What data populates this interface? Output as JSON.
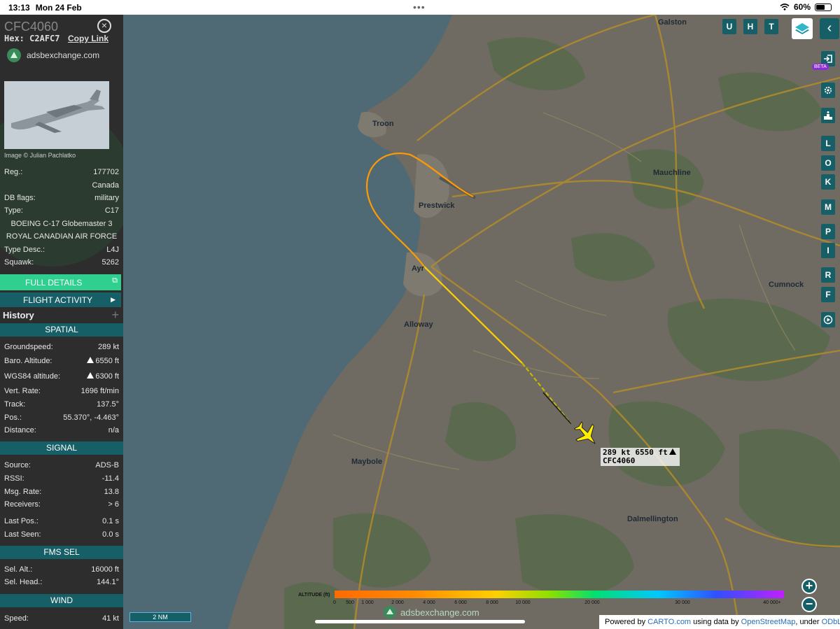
{
  "status_bar": {
    "time": "13:13",
    "date": "Mon 24 Feb",
    "battery": "60%",
    "battery_level": 0.6
  },
  "aircraft": {
    "callsign": "CFC4060",
    "hex_label": "Hex:",
    "hex": "C2AFC7",
    "copy_link": "Copy Link",
    "source_site": "adsbexchange.com",
    "photo_credit": "Image © Julian Pachlatko"
  },
  "info": {
    "reg_label": "Reg.:",
    "reg": "177702",
    "country": "Canada",
    "dbflags_label": "DB flags:",
    "dbflags": "military",
    "type_label": "Type:",
    "type": "C17",
    "model": "BOEING C-17 Globemaster 3",
    "operator": "ROYAL CANADIAN AIR FORCE",
    "typedesc_label": "Type Desc.:",
    "typedesc": "L4J",
    "squawk_label": "Squawk:",
    "squawk": "5262"
  },
  "buttons": {
    "full_details": "FULL DETAILS",
    "flight_activity": "FLIGHT ACTIVITY",
    "history": "History"
  },
  "spatial": {
    "title": "SPATIAL",
    "groundspeed_label": "Groundspeed:",
    "groundspeed": "289 kt",
    "baro_label": "Baro. Altitude:",
    "baro": "6550 ft",
    "wgs_label": "WGS84 altitude:",
    "wgs": "6300 ft",
    "vrate_label": "Vert. Rate:",
    "vrate": "1696 ft/min",
    "track_label": "Track:",
    "track": "137.5°",
    "pos_label": "Pos.:",
    "pos": "55.370°, -4.463°",
    "distance_label": "Distance:",
    "distance": "n/a"
  },
  "signal": {
    "title": "SIGNAL",
    "source_label": "Source:",
    "source": "ADS-B",
    "rssi_label": "RSSI:",
    "rssi": "-11.4",
    "msgrate_label": "Msg. Rate:",
    "msgrate": "13.8",
    "receivers_label": "Receivers:",
    "receivers": "> 6",
    "lastpos_label": "Last Pos.:",
    "lastpos": "0.1 s",
    "lastseen_label": "Last Seen:",
    "lastseen": "0.0 s"
  },
  "fms": {
    "title": "FMS SEL",
    "selalt_label": "Sel. Alt.:",
    "selalt": "16000 ft",
    "selhead_label": "Sel. Head.:",
    "selhead": "144.1°"
  },
  "wind": {
    "title": "WIND",
    "speed_label": "Speed:",
    "speed": "41 kt"
  },
  "map": {
    "places": [
      "Galston",
      "Troon",
      "Mauchline",
      "Prestwick",
      "Ayr",
      "Cumnock",
      "Alloway",
      "Maybole",
      "Dalmellington"
    ],
    "aircraft_label_line1": "289 kt  6550 ft",
    "aircraft_label_line2": "CFC4060",
    "scale": "2 NM",
    "legend_title": "ALTITUDE (ft)",
    "legend_ticks": [
      "0",
      "500",
      "1 000",
      "2 000",
      "4 000",
      "6 000",
      "8 000",
      "10 000",
      "20 000",
      "30 000",
      "40 000+"
    ],
    "watermark": "adsbexchange.com",
    "attribution_1": "Powered by ",
    "attribution_carto": "CARTO.com",
    "attribution_2": " using data by ",
    "attribution_osm": "OpenStreetMap",
    "attribution_3": ", under ",
    "attribution_odbl": "ODbL",
    "attribution_4": "."
  },
  "controls": {
    "top": [
      "U",
      "H",
      "T"
    ],
    "right": [
      "L",
      "O",
      "K",
      "M",
      "P",
      "I",
      "R",
      "F"
    ],
    "beta": "BETA",
    "zoom_in": "+",
    "zoom_out": "−",
    "close": "×",
    "collapse": "‹"
  },
  "colors": {
    "panel": "#2d2d2d",
    "teal": "#175f66",
    "green": "#2ecf8f",
    "water": "#4f6a74",
    "land": "#6f6b62",
    "forest": "#5b6a4e",
    "roads": "#b08a2c",
    "aircraft": "#ffee00"
  }
}
